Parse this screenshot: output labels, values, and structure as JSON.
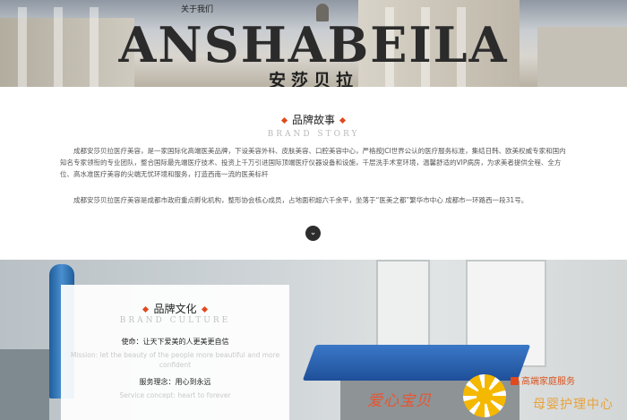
{
  "nav": {
    "about_link": "关于我们"
  },
  "hero": {
    "brand_en": "ANSHABEILA",
    "brand_cn": "安莎贝拉"
  },
  "story": {
    "title": "品牌故事",
    "subtitle_en": "BRAND STORY",
    "paragraphs": [
      "成都安莎贝拉医疗美容，是一家国际化高端医美品牌，下设美容外科、皮肤美容、口腔美容中心，严格按JCI世界公认的医疗服务标准，集结日韩、欧美权威专家和国内知名专家领衔的专业团队，整合国际最先端医疗技术、投资上千万引进国际顶端医疗仪器设备和设施，千层洗手术室环境，温馨舒适的VIP病房，为求美者提供全程、全方位、高水准医疗美容的尖端无忧环境和服务，打造西南一流的医美标杆",
      "成都安莎贝拉医疗美容是成都市政府重点孵化机构，整形协会核心成员，占地面积超六千余平，坐落于“医美之都”繁华市中心 成都市一环路西一段31号。"
    ],
    "scroll_icon": "chevron-down-icon"
  },
  "culture": {
    "title": "品牌文化",
    "subtitle_en": "BRAND CULTURE",
    "mission": "使命：让天下爱美的人更美更自信",
    "mission_en": "Mission: let the beauty of the people more beautiful and more confident",
    "idea": "服务理念：用心到永远",
    "idea_en": "Service concept: heart to forever"
  },
  "watermark": {
    "name": "爱心宝贝",
    "tag": "高端家庭服务",
    "center": "母婴护理中心"
  },
  "colors": {
    "accent": "#e04a1c",
    "watermark_orange": "#e8552e",
    "watermark_gold": "#f5b800"
  }
}
